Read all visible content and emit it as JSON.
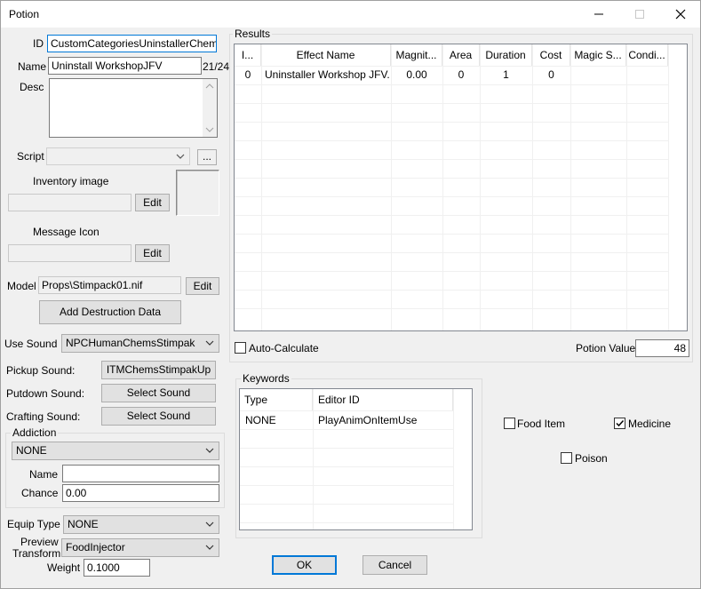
{
  "window": {
    "title": "Potion"
  },
  "form": {
    "id_label": "ID",
    "id_value": "CustomCategoriesUninstallerChemJFV",
    "name_label": "Name",
    "name_value": "Uninstall WorkshopJFV",
    "name_count": "21/24",
    "desc_label": "Desc",
    "script_label": "Script",
    "script_browse": "...",
    "inventory_image_label": "Inventory image",
    "edit_label": "Edit",
    "message_icon_label": "Message Icon",
    "model_label": "Model",
    "model_value": "Props\\Stimpack01.nif",
    "add_destruction_label": "Add Destruction Data",
    "use_sound_label": "Use Sound",
    "use_sound_value": "NPCHumanChemsStimpak",
    "pickup_sound_label": "Pickup Sound:",
    "pickup_sound_value": "ITMChemsStimpakUp",
    "putdown_sound_label": "Putdown Sound:",
    "putdown_sound_value": "Select Sound",
    "crafting_sound_label": "Crafting Sound:",
    "crafting_sound_value": "Select Sound",
    "addiction_label": "Addiction",
    "addiction_value": "NONE",
    "addiction_name_label": "Name",
    "addiction_name_value": "",
    "chance_label": "Chance",
    "chance_value": "0.00",
    "equip_type_label": "Equip Type",
    "equip_type_value": "NONE",
    "preview_label_1": "Preview",
    "preview_label_2": "Transform",
    "preview_value": "FoodInjector",
    "weight_label": "Weight",
    "weight_value": "0.1000"
  },
  "results": {
    "title": "Results",
    "columns": [
      "I...",
      "Effect Name",
      "Magnit...",
      "Area",
      "Duration",
      "Cost",
      "Magic S...",
      "Condi..."
    ],
    "rows": [
      [
        "0",
        "Uninstaller Workshop JFV...",
        "0.00",
        "0",
        "1",
        "0",
        "",
        ""
      ]
    ],
    "auto_calculate_label": "Auto-Calculate",
    "auto_calculate_checked": false,
    "potion_value_label": "Potion Value",
    "potion_value": "48"
  },
  "keywords": {
    "title": "Keywords",
    "columns": [
      "Type",
      "Editor ID"
    ],
    "rows": [
      [
        "NONE",
        "PlayAnimOnItemUse"
      ]
    ]
  },
  "flags": {
    "food_item_label": "Food Item",
    "food_item_checked": false,
    "medicine_label": "Medicine",
    "medicine_checked": true,
    "poison_label": "Poison",
    "poison_checked": false
  },
  "buttons": {
    "ok": "OK",
    "cancel": "Cancel"
  }
}
